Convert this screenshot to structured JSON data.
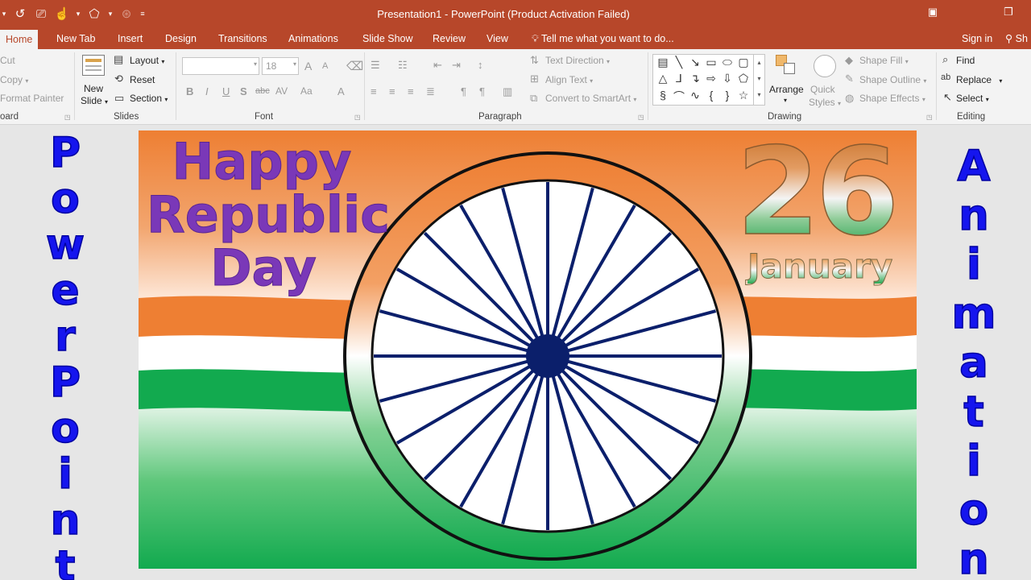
{
  "titlebar": {
    "window_title": "Presentation1 - PowerPoint (Product Activation Failed)",
    "qat_icons": [
      "menu-caret-icon",
      "undo-icon",
      "presenter-icon",
      "touch-mode-icon",
      "dropdown-caret-icon",
      "shapes-icon",
      "dropdown-caret-icon",
      "dimmed-icon",
      "customize-qat-icon"
    ]
  },
  "tabs": [
    "Home",
    "New Tab",
    "Insert",
    "Design",
    "Transitions",
    "Animations",
    "Slide Show",
    "Review",
    "View"
  ],
  "tell_me": "Tell me what you want to do...",
  "sign_in": "Sign in",
  "share": "Sh",
  "ribbon": {
    "clipboard": {
      "cut": "Cut",
      "copy": "Copy",
      "format_painter": "Format Painter",
      "group": "oard"
    },
    "slides": {
      "new_slide_top": "New",
      "new_slide_bottom": "Slide",
      "layout": "Layout",
      "reset": "Reset",
      "section": "Section",
      "group": "Slides"
    },
    "font": {
      "size": "18",
      "group": "Font",
      "bold": "B",
      "italic": "I",
      "underline": "U",
      "shadow": "S",
      "strike": "abc",
      "spacing": "AV",
      "case": "Aa",
      "color": "A",
      "grow": "A",
      "shrink": "A"
    },
    "paragraph": {
      "text_direction": "Text Direction",
      "align_text": "Align Text",
      "convert_smartart": "Convert to SmartArt",
      "group": "Paragraph"
    },
    "drawing": {
      "arrange": "Arrange",
      "quick_top": "Quick",
      "quick_bottom": "Styles",
      "shape_fill": "Shape Fill",
      "shape_outline": "Shape Outline",
      "shape_effects": "Shape Effects",
      "group": "Drawing"
    },
    "editing": {
      "find": "Find",
      "replace": "Replace",
      "select": "Select",
      "group": "Editing"
    }
  },
  "side_left": "PowerPoint",
  "side_right": "Animation",
  "slide": {
    "line1": "Happy",
    "line2": "Republic",
    "line3": "Day",
    "number": "26",
    "month": "January",
    "spokes": 24,
    "colors": {
      "saffron": "#ee7f33",
      "green": "#12aa4f",
      "navy": "#0b1f6b",
      "purple": "#7a38b8",
      "ribbon": "#b7472a"
    }
  }
}
